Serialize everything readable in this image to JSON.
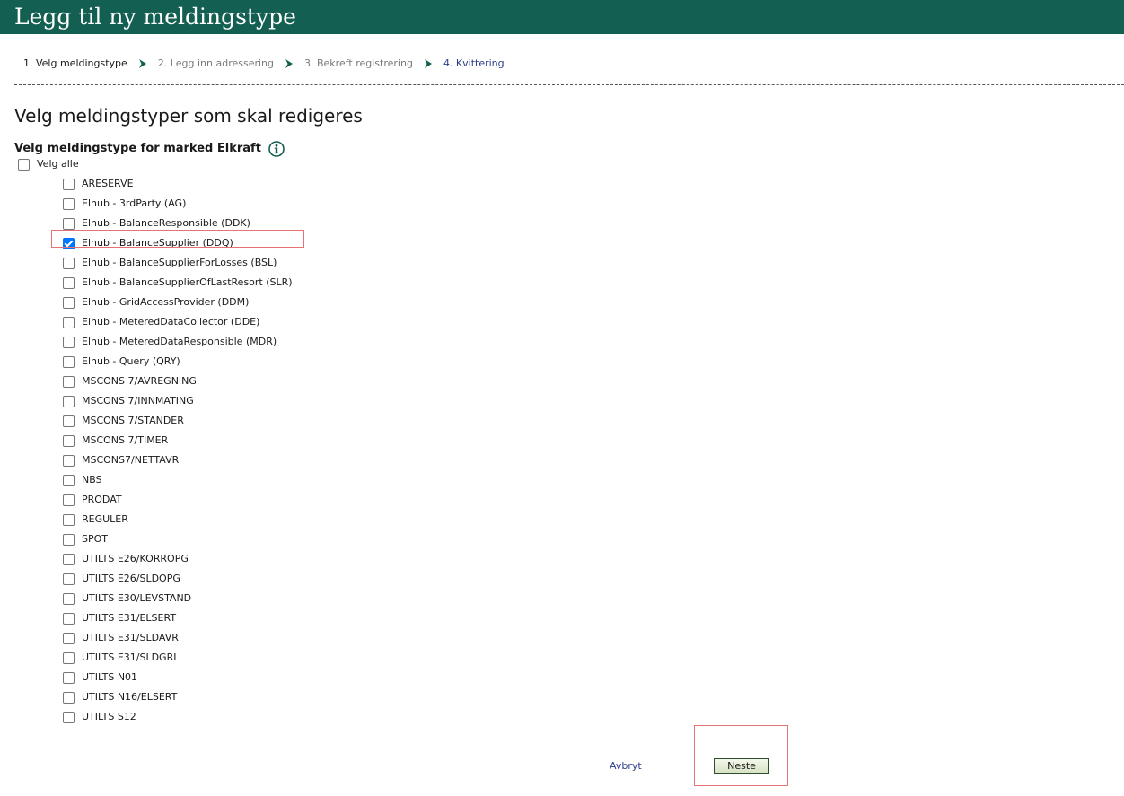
{
  "header": {
    "title": "Legg til ny meldingstype"
  },
  "steps": [
    {
      "label": "1. Velg meldingstype",
      "state": "active"
    },
    {
      "label": "2. Legg inn adressering",
      "state": "inactive"
    },
    {
      "label": "3. Bekreft registrering",
      "state": "inactive"
    },
    {
      "label": "4. Kvittering",
      "state": "linked"
    }
  ],
  "page_title": "Velg meldingstyper som skal redigeres",
  "section": {
    "title": "Velg meldingstype for marked Elkraft",
    "info_icon": "info-icon"
  },
  "select_all": {
    "label": "Velg alle",
    "checked": false
  },
  "message_types": [
    {
      "label": "ARESERVE",
      "checked": false
    },
    {
      "label": "Elhub - 3rdParty (AG)",
      "checked": false
    },
    {
      "label": "Elhub - BalanceResponsible (DDK)",
      "checked": false
    },
    {
      "label": "Elhub - BalanceSupplier (DDQ)",
      "checked": true
    },
    {
      "label": "Elhub - BalanceSupplierForLosses (BSL)",
      "checked": false
    },
    {
      "label": "Elhub - BalanceSupplierOfLastResort (SLR)",
      "checked": false
    },
    {
      "label": "Elhub - GridAccessProvider (DDM)",
      "checked": false
    },
    {
      "label": "Elhub - MeteredDataCollector (DDE)",
      "checked": false
    },
    {
      "label": "Elhub - MeteredDataResponsible (MDR)",
      "checked": false
    },
    {
      "label": "Elhub - Query (QRY)",
      "checked": false
    },
    {
      "label": "MSCONS 7/AVREGNING",
      "checked": false
    },
    {
      "label": "MSCONS 7/INNMATING",
      "checked": false
    },
    {
      "label": "MSCONS 7/STANDER",
      "checked": false
    },
    {
      "label": "MSCONS 7/TIMER",
      "checked": false
    },
    {
      "label": "MSCONS7/NETTAVR",
      "checked": false
    },
    {
      "label": "NBS",
      "checked": false
    },
    {
      "label": "PRODAT",
      "checked": false
    },
    {
      "label": "REGULER",
      "checked": false
    },
    {
      "label": "SPOT",
      "checked": false
    },
    {
      "label": "UTILTS E26/KORROPG",
      "checked": false
    },
    {
      "label": "UTILTS E26/SLDOPG",
      "checked": false
    },
    {
      "label": "UTILTS E30/LEVSTAND",
      "checked": false
    },
    {
      "label": "UTILTS E31/ELSERT",
      "checked": false
    },
    {
      "label": "UTILTS E31/SLDAVR",
      "checked": false
    },
    {
      "label": "UTILTS E31/SLDGRL",
      "checked": false
    },
    {
      "label": "UTILTS N01",
      "checked": false
    },
    {
      "label": "UTILTS N16/ELSERT",
      "checked": false
    },
    {
      "label": "UTILTS S12",
      "checked": false
    }
  ],
  "actions": {
    "cancel_label": "Avbryt",
    "next_label": "Neste"
  },
  "colors": {
    "header_bg": "#136052",
    "link": "#2d3d8c",
    "checkbox_checked": "#0075ff",
    "highlight": "#e57373"
  }
}
